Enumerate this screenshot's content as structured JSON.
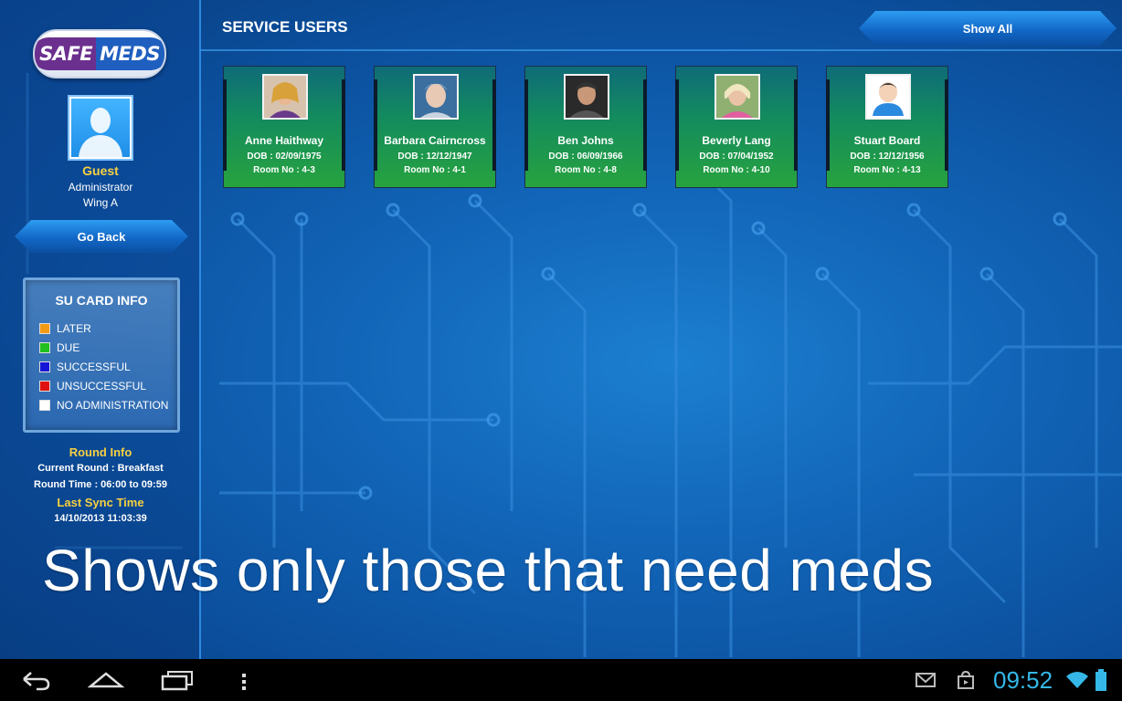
{
  "header": {
    "title": "SERVICE USERS",
    "show_all_label": "Show All"
  },
  "sidebar": {
    "logo": {
      "part1": "SAFE",
      "part2": "MEDS"
    },
    "user": {
      "name": "Guest",
      "role": "Administrator",
      "wing": "Wing A"
    },
    "go_back_label": "Go Back",
    "legend": {
      "title": "SU CARD INFO",
      "items": [
        {
          "label": "LATER",
          "color": "#f49a12"
        },
        {
          "label": "DUE",
          "color": "#20c020"
        },
        {
          "label": "SUCCESSFUL",
          "color": "#1515d8"
        },
        {
          "label": "UNSUCCESSFUL",
          "color": "#e01010"
        },
        {
          "label": "NO ADMINISTRATION",
          "color": "#ffffff"
        }
      ]
    },
    "round_info": {
      "title": "Round Info",
      "current_round": "Current Round : Breakfast",
      "round_time": "Round Time : 06:00 to 09:59"
    },
    "sync": {
      "title": "Last Sync Time",
      "value": "14/10/2013 11:03:39"
    }
  },
  "service_users": [
    {
      "name": "Anne Haithway",
      "dob": "DOB : 02/09/1975",
      "room": "Room No : 4-3"
    },
    {
      "name": "Barbara Cairncross",
      "dob": "DOB : 12/12/1947",
      "room": "Room No : 4-1"
    },
    {
      "name": "Ben Johns",
      "dob": "DOB : 06/09/1966",
      "room": "Room No : 4-8"
    },
    {
      "name": "Beverly Lang",
      "dob": "DOB : 07/04/1952",
      "room": "Room No : 4-10"
    },
    {
      "name": "Stuart Board",
      "dob": "DOB : 12/12/1956",
      "room": "Room No : 4-13"
    }
  ],
  "caption": "Shows only those that need meds",
  "status_bar": {
    "time": "09:52"
  },
  "icons": {
    "nav": [
      "back-icon",
      "home-icon",
      "recent-apps-icon",
      "menu-icon"
    ],
    "status": [
      "gmail-icon",
      "play-store-icon",
      "wifi-icon",
      "battery-icon"
    ]
  }
}
